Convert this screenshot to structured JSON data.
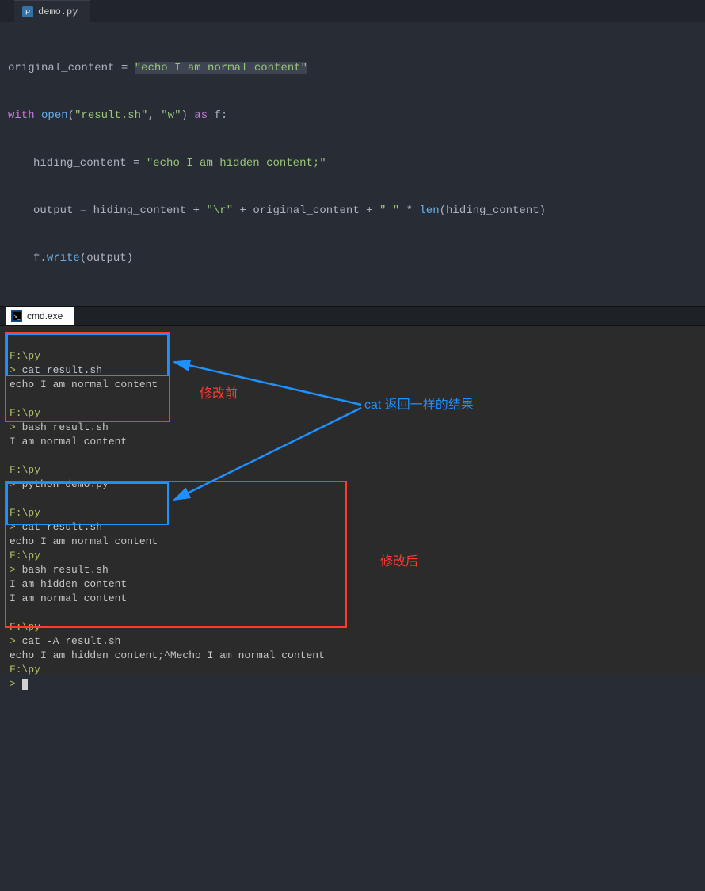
{
  "editor": {
    "tab": {
      "filename": "demo.py"
    },
    "code": {
      "l1_var": "original_content",
      "l1_eq": " = ",
      "l1_str": "\"echo I am normal content\"",
      "l2_kw1": "with",
      "l2_sp1": " ",
      "l2_fn1": "open",
      "l2_paren_open": "(",
      "l2_arg1": "\"result.sh\"",
      "l2_comma": ", ",
      "l2_arg2": "\"w\"",
      "l2_paren_close": ")",
      "l2_sp2": " ",
      "l2_kw2": "as",
      "l2_sp3": " f:",
      "l3_var": "hiding_content",
      "l3_eq": " = ",
      "l3_str": "\"echo I am hidden content;\"",
      "l4_var": "output",
      "l4_eq": " = ",
      "l4_expr_a": "hiding_content",
      "l4_plus1": " + ",
      "l4_str1": "\"\\r\"",
      "l4_plus2": " + ",
      "l4_expr_b": "original_content",
      "l4_plus3": " + ",
      "l4_str2": "\" \"",
      "l4_mul": " * ",
      "l4_fn": "len",
      "l4_po": "(",
      "l4_arg": "hiding_content",
      "l4_pc": ")",
      "l5_obj": "f",
      "l5_dot": ".",
      "l5_fn": "write",
      "l5_po": "(",
      "l5_arg": "output",
      "l5_pc": ")"
    }
  },
  "term_tab": {
    "label": "cmd.exe"
  },
  "terminal": {
    "b1_path": "F:\\py",
    "b1_cmd": "cat result.sh",
    "b1_out": "echo I am normal content",
    "b2_path": "F:\\py",
    "b2_cmd": "bash result.sh",
    "b2_out": "I am normal content",
    "b3_path": "F:\\py",
    "b3_cmd": "python demo.py",
    "b4_path": "F:\\py",
    "b4_cmd": "cat result.sh",
    "b4_out": "echo I am normal content",
    "b5_path": "F:\\py",
    "b5_cmd": "bash result.sh",
    "b5_out1": "I am hidden content",
    "b5_out2": "I am normal content",
    "b6_path": "F:\\py",
    "b6_cmd": "cat -A result.sh",
    "b6_out": "echo I am hidden content;^Mecho I am normal content",
    "b7_path": "F:\\py",
    "gt": "> "
  },
  "annotations": {
    "before": "修改前",
    "after": "修改后",
    "cat_same": "cat 返回一样的结果"
  },
  "colors": {
    "red": "#ff3b30",
    "blue": "#1e90ff"
  }
}
